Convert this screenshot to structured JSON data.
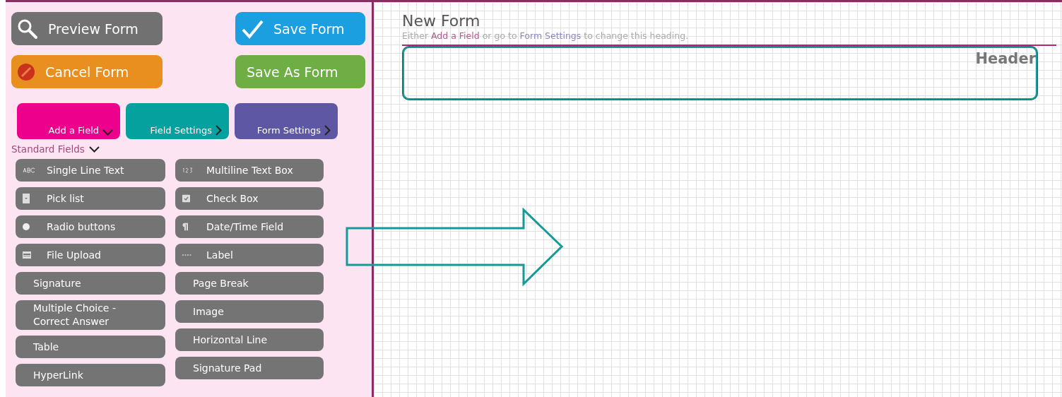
{
  "action_buttons": [
    {
      "label": "Preview Form",
      "kind": "preview",
      "color": "#717171"
    },
    {
      "label": "Save Form",
      "kind": "save",
      "color": "#1c9fe0"
    },
    {
      "label": "Cancel Form",
      "kind": "cancel",
      "color": "#e88f1f"
    },
    {
      "label": "Save As Form",
      "kind": "plain",
      "color": "#6fad45"
    }
  ],
  "tabs": [
    {
      "label": "Add a Field",
      "kind": "dropdown",
      "color": "#ec008c"
    },
    {
      "label": "Field Settings",
      "kind": "next",
      "color": "#04a19e"
    },
    {
      "label": "Form Settings",
      "kind": "next",
      "color": "#5d57a4"
    }
  ],
  "section": {
    "label": "Standard Fields",
    "expanded": true
  },
  "field_columns": [
    [
      {
        "label": "Single Line Text",
        "kind": "abc"
      },
      {
        "label": "Pick list",
        "kind": "picklist"
      },
      {
        "label": "Radio buttons",
        "kind": "radio"
      },
      {
        "label": "File Upload",
        "kind": "upload"
      },
      {
        "label": "Signature",
        "kind": "plain"
      },
      {
        "label": "Multiple Choice - Correct Answer",
        "kind": "plain"
      },
      {
        "label": "Table",
        "kind": "plain"
      },
      {
        "label": "HyperLink",
        "kind": "plain"
      }
    ],
    [
      {
        "label": "Multiline Text Box",
        "kind": "numbers"
      },
      {
        "label": "Check Box",
        "kind": "checkbox"
      },
      {
        "label": "Date/Time Field",
        "kind": "pilcrow"
      },
      {
        "label": "Label",
        "kind": "dashes"
      },
      {
        "label": "Page Break",
        "kind": "plain"
      },
      {
        "label": "Image",
        "kind": "plain"
      },
      {
        "label": "Horizontal Line",
        "kind": "plain"
      },
      {
        "label": "Signature Pad",
        "kind": "plain"
      }
    ]
  ],
  "form": {
    "title": "New Form",
    "subtitle": [
      {
        "text": "Either",
        "kind": "text"
      },
      {
        "text": "Add a Field",
        "kind": "link-pink"
      },
      {
        "text": "or go to",
        "kind": "text"
      },
      {
        "text": "Form Settings",
        "kind": "link-purple"
      },
      {
        "text": "to change this heading.",
        "kind": "text"
      }
    ],
    "header_label": "Header"
  }
}
